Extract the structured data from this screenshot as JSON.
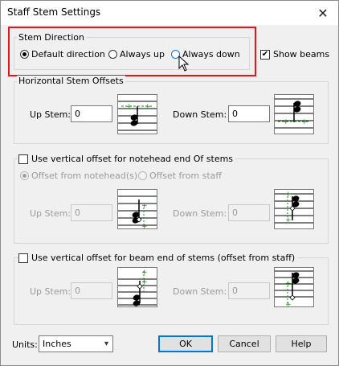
{
  "window": {
    "title": "Staff Stem Settings",
    "close_label": "✕"
  },
  "stem_direction": {
    "group_label": "Stem Direction",
    "options": [
      {
        "label": "Default direction",
        "selected": true
      },
      {
        "label": "Always up",
        "selected": false
      },
      {
        "label": "Always down",
        "selected": false
      }
    ],
    "show_beams": {
      "label": "Show beams",
      "checked": true
    }
  },
  "horizontal_offsets": {
    "group_label": "Horizontal Stem Offsets",
    "up_label": "Up Stem:",
    "up_value": "0",
    "down_label": "Down Stem:",
    "down_value": "0"
  },
  "vertical_notehead": {
    "checkbox_label": "Use vertical offset for notehead end Of stems",
    "checked": false,
    "radio_notehead": "Offset from notehead(s)",
    "radio_staff": "Offset from staff",
    "up_label": "Up Stem:",
    "up_value": "0",
    "down_label": "Down Stem:",
    "down_value": "0"
  },
  "vertical_beam": {
    "checkbox_label": "Use vertical offset for beam end of stems (offset from staff)",
    "checked": false,
    "up_label": "Up Stem:",
    "up_value": "0",
    "down_label": "Down Stem:",
    "down_value": "0"
  },
  "footer": {
    "units_label": "Units:",
    "units_value": "Inches",
    "ok": "OK",
    "cancel": "Cancel",
    "help": "Help"
  },
  "colors": {
    "highlight": "#e8141c",
    "guide": "#1a8a1a",
    "focus": "#0078d7"
  }
}
